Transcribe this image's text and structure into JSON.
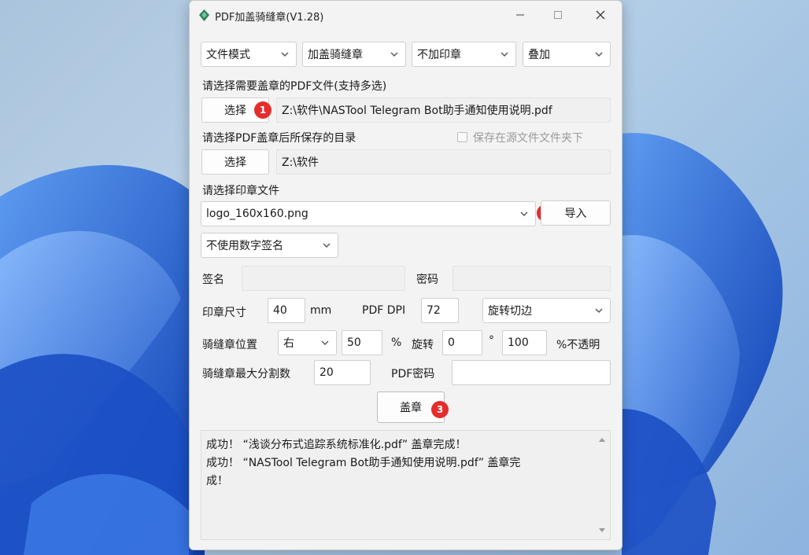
{
  "window": {
    "title": "PDF加盖骑缝章(V1.28)",
    "controls": {
      "minimize": "—",
      "maximize": "☐",
      "close": "✕"
    }
  },
  "top_row": {
    "mode": "文件模式",
    "seal_type": "加盖骑缝章",
    "stamp_mode": "不加印章",
    "overlay": "叠加"
  },
  "source": {
    "label": "请选择需要盖章的PDF文件(支持多选)",
    "button": "选择",
    "path": "Z:\\软件\\NASTool Telegram Bot助手通知使用说明.pdf",
    "step": "1"
  },
  "output": {
    "label": "请选择PDF盖章后所保存的目录",
    "save_in_source_label": "保存在源文件文件夹下",
    "button": "选择",
    "path": "Z:\\软件"
  },
  "stamp_file": {
    "label": "请选择印章文件",
    "selected": "logo_160x160.png",
    "import_button": "导入",
    "step": "2"
  },
  "signature": {
    "mode": "不使用数字签名",
    "sign_label": "签名",
    "sign_value": "",
    "password_label": "密码",
    "password_value": ""
  },
  "params": {
    "size_label": "印章尺寸",
    "size_value": "40",
    "size_unit": "mm",
    "dpi_label": "PDF DPI",
    "dpi_value": "72",
    "rotate_mode": "旋转切边",
    "position_label": "骑缝章位置",
    "position_value": "右",
    "percent_value": "50",
    "percent_unit": "%",
    "rotate_label": "旋转",
    "rotate_value": "0",
    "degree_unit": "°",
    "opacity_value": "100",
    "opacity_label": "%不透明",
    "max_split_label": "骑缝章最大分割数",
    "max_split_value": "20",
    "pdf_password_label": "PDF密码",
    "pdf_password_value": ""
  },
  "action": {
    "stamp_button": "盖章",
    "step": "3"
  },
  "log": {
    "lines": [
      "成功！ “浅谈分布式追踪系统标准化.pdf” 盖章完成！",
      "成功！ “NASTool Telegram Bot助手通知使用说明.pdf” 盖章完",
      "成！"
    ]
  },
  "colors": {
    "badge": "#e52d2d",
    "window_bg": "#f3f3f3",
    "wallpaper_blue": "#2f6fd6"
  }
}
